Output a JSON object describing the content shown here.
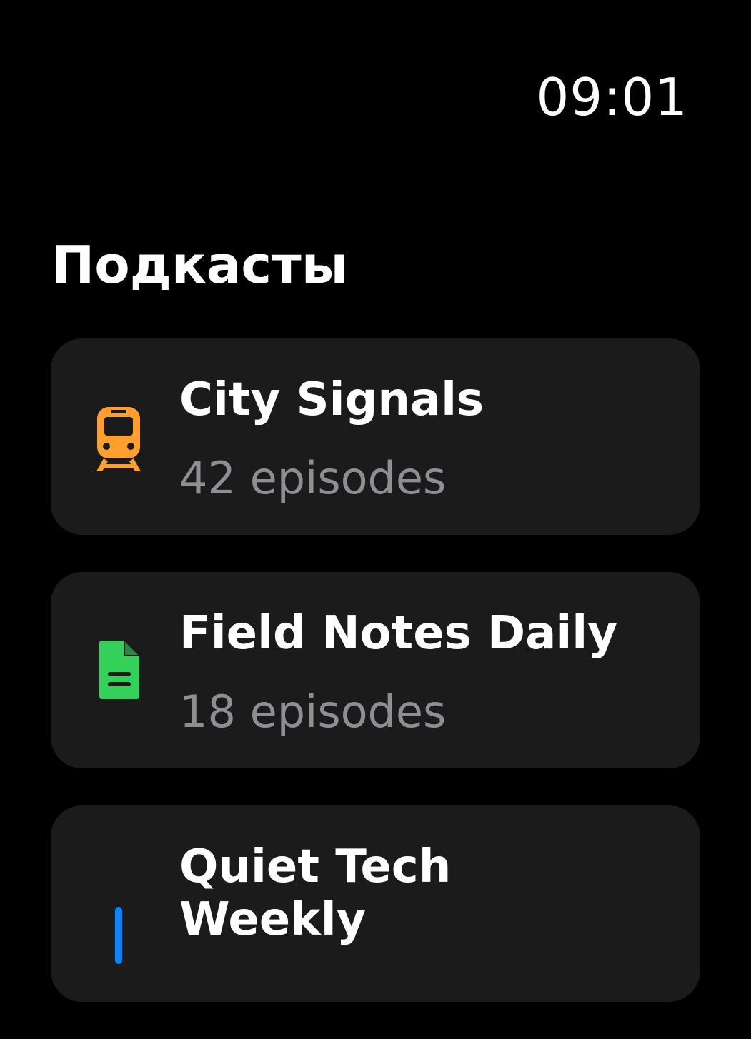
{
  "status_bar": {
    "time": "09:01"
  },
  "header": {
    "title": "Подкасты"
  },
  "podcasts": [
    {
      "title": "City Signals",
      "subtitle": "42 episodes",
      "icon": "tram-icon",
      "color": "#ff9f2e"
    },
    {
      "title": "Field Notes Daily",
      "subtitle": "18 episodes",
      "icon": "document-icon",
      "color": "#33d15a"
    },
    {
      "title": "Quiet Tech Weekly",
      "subtitle": "",
      "icon": "broadcast-icon",
      "color": "#0a84ff"
    }
  ]
}
